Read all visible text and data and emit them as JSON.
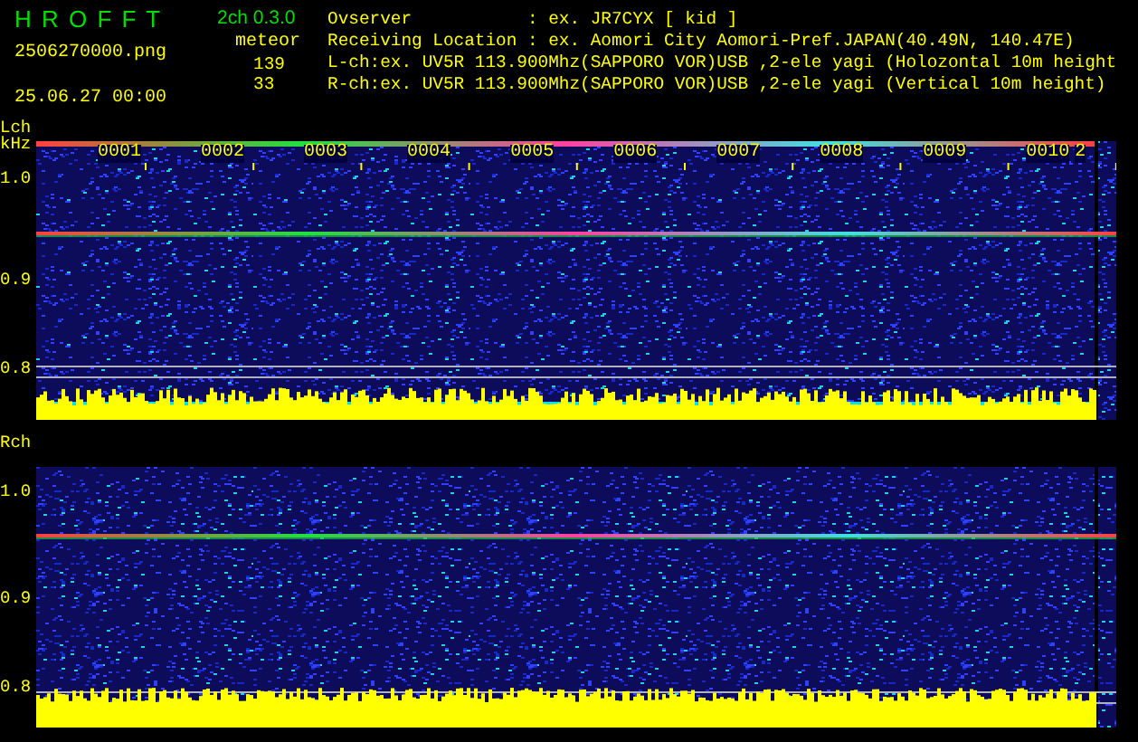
{
  "header": {
    "app_title": "H R O F F T",
    "version": "2ch 0.3.0",
    "file_name": "2506270000.png",
    "date_time": "25.06.27 00:00",
    "meteor_label": "meteor",
    "meteor_counts": [
      "139",
      "33"
    ],
    "info_lines": [
      "Ovserver           : ex. JR7CYX [ kid ]",
      "Receiving Location : ex. Aomori City Aomori-Pref.JAPAN(40.49N, 140.47E)",
      "L-ch:ex. UV5R 113.900Mhz(SAPPORO VOR)USB ,2-ele yagi (Holozontal 10m height",
      "R-ch:ex. UV5R 113.900Mhz(SAPPORO VOR)USB ,2-ele yagi (Vertical 10m height)"
    ]
  },
  "channels": [
    {
      "label": "Lch",
      "unit": "kHz",
      "axis_labels": [
        "1.0",
        "0.9",
        "0.8"
      ],
      "minute_labels": [
        "0001",
        "0002",
        "0003",
        "0004",
        "0005",
        "0006",
        "0007",
        "0008",
        "0009",
        "0010",
        "2"
      ]
    },
    {
      "label": "Rch",
      "axis_labels": [
        "1.0",
        "0.9",
        "0.8"
      ]
    }
  ]
}
